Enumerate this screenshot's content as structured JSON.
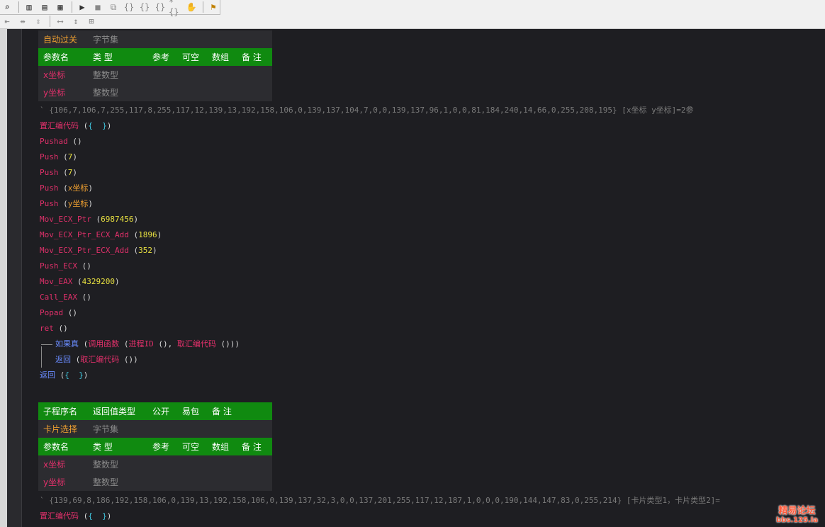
{
  "toolbar": {
    "row1_icons": [
      "zoom-icon",
      "layout-split-icon",
      "layout-rows-icon",
      "layout-grid-icon",
      "run-icon",
      "stop-icon",
      "step-icon",
      "step-into-icon",
      "step-over-icon",
      "step-out-icon",
      "breakpoint-icon",
      "hand-icon",
      "find-icon"
    ],
    "row2_icons": [
      "align-left-icon",
      "align-center-icon",
      "align-vert-icon",
      "width-icon",
      "height-icon",
      "size-icon"
    ]
  },
  "table1": {
    "name": "自动过关",
    "type": "字节集",
    "headers": [
      "参数名",
      "类 型",
      "参考",
      "可空",
      "数组",
      "备 注"
    ],
    "params": [
      {
        "name": "x坐标",
        "type": "整数型"
      },
      {
        "name": "y坐标",
        "type": "整数型"
      }
    ]
  },
  "code1": {
    "comment": "` {106,7,106,7,255,117,8,255,117,12,139,13,192,158,106,0,139,137,104,7,0,0,139,137,96,1,0,0,81,184,240,14,66,0,255,208,195} [x坐标 y坐标]=2参",
    "lines": [
      {
        "fn": "置汇编代码",
        "args": "",
        "braces": true
      },
      {
        "fn": "Pushad",
        "args": ""
      },
      {
        "fn": "Push",
        "num": "7"
      },
      {
        "fn": "Push",
        "num": "7"
      },
      {
        "fn": "Push",
        "var": "x坐标"
      },
      {
        "fn": "Push",
        "var": "y坐标"
      },
      {
        "fn": "Mov_ECX_Ptr",
        "num": "6987456"
      },
      {
        "fn": "Mov_ECX_Ptr_ECX_Add",
        "num": "1896"
      },
      {
        "fn": "Mov_ECX_Ptr_ECX_Add",
        "num": "352"
      },
      {
        "fn": "Push_ECX",
        "args": ""
      },
      {
        "fn": "Mov_EAX",
        "num": "4329200"
      },
      {
        "fn": "Call_EAX",
        "args": ""
      },
      {
        "fn": "Popad",
        "args": ""
      },
      {
        "fn": "ret",
        "args": ""
      }
    ],
    "if_kw": "如果真",
    "if_call": "调用函数",
    "if_arg1": "进程ID",
    "if_arg2": "取汇编代码",
    "return_kw": "返回",
    "return_arg": "取汇编代码",
    "final_return": "返回"
  },
  "table2": {
    "headers": [
      "子程序名",
      "返回值类型",
      "公开",
      "易包",
      "备 注"
    ],
    "name": "卡片选择",
    "type": "字节集",
    "param_headers": [
      "参数名",
      "类 型",
      "参考",
      "可空",
      "数组",
      "备 注"
    ],
    "params": [
      {
        "name": "x坐标",
        "type": "整数型"
      },
      {
        "name": "y坐标",
        "type": "整数型"
      }
    ]
  },
  "code2": {
    "comment": "` {139,69,8,186,192,158,106,0,139,13,192,158,106,0,139,137,32,3,0,0,137,201,255,117,12,187,1,0,0,0,190,144,147,83,0,255,214} [卡片类型1，卡片类型2]=",
    "first_fn": "置汇编代码"
  },
  "watermark": {
    "line1": "精易论坛",
    "line2": "bbs.125.la"
  }
}
